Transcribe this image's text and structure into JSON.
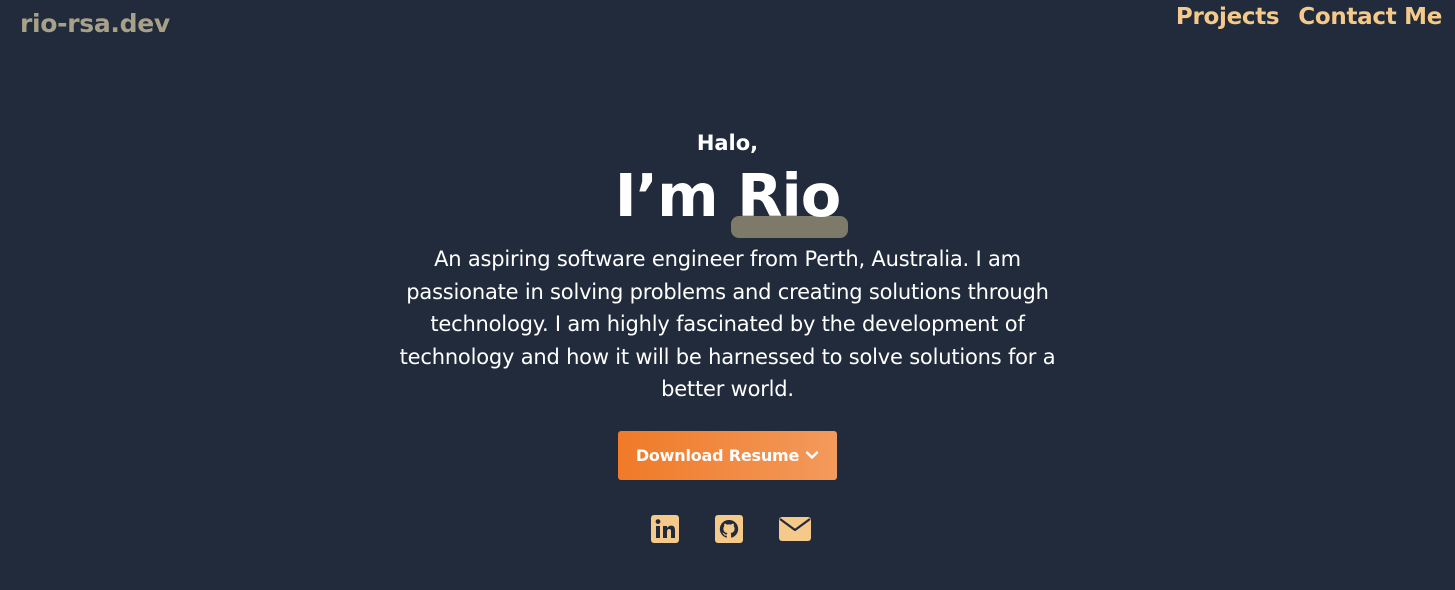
{
  "header": {
    "logo": "rio-rsa.dev",
    "nav": [
      {
        "label": "Projects"
      },
      {
        "label": "Contact Me"
      }
    ]
  },
  "hero": {
    "greeting": "Halo,",
    "headline_prefix": "I’m ",
    "headline_name": "Rio",
    "bio": "An aspiring software engineer from Perth, Australia. I am passionate in solving problems and creating solutions through technology. I am highly fascinated by the development of technology and how it will be harnessed to solve solutions for a better world.",
    "resume_button": "Download Resume",
    "resume_icon": "chevron-down-icon"
  },
  "socials": [
    {
      "icon": "linkedin-icon"
    },
    {
      "icon": "github-icon"
    },
    {
      "icon": "mail-icon"
    }
  ],
  "colors": {
    "background": "#212b3b",
    "accent": "#f5c98a",
    "logo": "#a8a18a",
    "button_start": "#f07a28",
    "button_end": "#f39a5c",
    "highlight": "#7d7a69"
  }
}
